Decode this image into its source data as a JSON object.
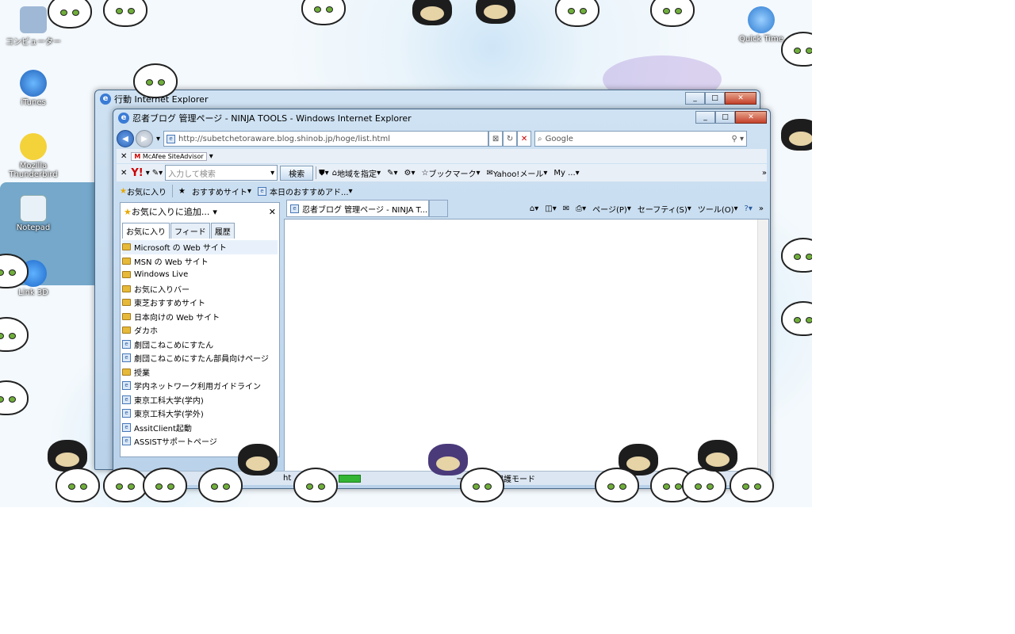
{
  "desktop": {
    "icons": [
      {
        "label": "コンピューター",
        "icon": "computer-icon"
      },
      {
        "label": "iTunes",
        "icon": "itunes-icon"
      },
      {
        "label": "Mozilla Thunderbird",
        "icon": "thunderbird-icon"
      },
      {
        "label": "Notepad",
        "icon": "notepad-icon"
      },
      {
        "label": "Link 3D",
        "icon": "link-icon"
      },
      {
        "label": "Quick Time",
        "icon": "quicktime-icon"
      }
    ]
  },
  "back_window": {
    "title": "行動 Internet Explorer"
  },
  "ie": {
    "title": "忍者ブログ 管理ページ - NINJA TOOLS - Windows Internet Explorer",
    "address": "http://subetchetoraware.blog.shinob.jp/hoge/list.html",
    "search_placeholder": "Google",
    "mcafee_label": "McAfee SiteAdvisor",
    "yahoo": {
      "search_placeholder": "入力して検索",
      "search_button": "検索",
      "items": [
        "地域を指定",
        "ブックマーク",
        "Yahoo!メール",
        "My ..."
      ]
    },
    "favbar": {
      "favorites_label": "お気に入り",
      "items": [
        "おすすめサイト",
        "本日のおすすめアド..."
      ]
    },
    "pane": {
      "add_label": "お気に入りに追加...",
      "tabs": [
        "お気に入り",
        "フィード",
        "履歴"
      ],
      "items": [
        {
          "label": "Microsoft の Web サイト",
          "type": "folder"
        },
        {
          "label": "MSN の Web サイト",
          "type": "folder"
        },
        {
          "label": "Windows Live",
          "type": "folder"
        },
        {
          "label": "お気に入りバー",
          "type": "folder"
        },
        {
          "label": "東芝おすすめサイト",
          "type": "folder"
        },
        {
          "label": "日本向けの Web サイト",
          "type": "folder"
        },
        {
          "label": "ダカホ",
          "type": "folder"
        },
        {
          "label": "劇団こねこめにすたん",
          "type": "link"
        },
        {
          "label": "劇団こねこめにすたん部員向けページ",
          "type": "link"
        },
        {
          "label": "授業",
          "type": "folder"
        },
        {
          "label": "学内ネットワーク利用ガイドライン",
          "type": "link"
        },
        {
          "label": "東京工科大学(学内)",
          "type": "link"
        },
        {
          "label": "東京工科大学(学外)",
          "type": "link"
        },
        {
          "label": "AssitClient起動",
          "type": "link"
        },
        {
          "label": "ASSISTサポートページ",
          "type": "link"
        }
      ]
    },
    "tab": {
      "label": "忍者ブログ 管理ページ - NINJA T..."
    },
    "commandbar": {
      "page": "ページ(P)",
      "safety": "セーフティ(S)",
      "tools": "ツール(O)"
    },
    "status": {
      "left": "ht",
      "zone": "ーネット | 保護モード"
    }
  }
}
